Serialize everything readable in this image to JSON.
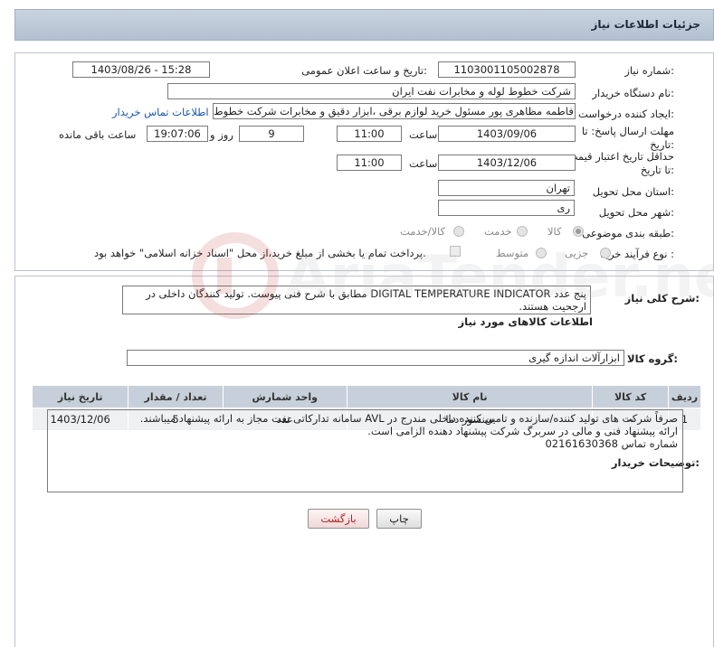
{
  "header": {
    "title": "جزئیات اطلاعات نیاز"
  },
  "form": {
    "need_number_label": "شماره نیاز:",
    "need_number": "1103001105002878",
    "announce_label": "تاریخ و ساعت اعلان عمومی:",
    "announce_value": "1403/08/26 - 15:28",
    "buyer_org_label": "نام دستگاه خریدار:",
    "buyer_org": "شرکت خطوط لوله و مخابرات نفت ایران",
    "requester_label": "ایجاد کننده درخواست:",
    "requester": "فاطمه مظاهری پور مسئول خرید لوازم برقی ،ابزار دقیق و مخابرات شرکت خطوط",
    "contact_link": "اطلاعات تماس خریدار",
    "deadline_label": "مهلت ارسال پاسخ: تا تاریخ:",
    "deadline_date": "1403/09/06",
    "time_label": "ساعت",
    "deadline_time": "11:00",
    "days_value": "9",
    "days_label": "روز و",
    "remaining_time": "19:07:06",
    "remaining_label": "ساعت باقی مانده",
    "validity_label": "حداقل تاریخ اعتبار قیمت: تا تاریخ:",
    "validity_date": "1403/12/06",
    "validity_time": "11:00",
    "province_label": "استان محل تحویل:",
    "province": "تهران",
    "city_label": "شهر محل تحویل:",
    "city": "ری",
    "category_label": "طبقه بندی موضوعی:",
    "category_options": [
      "کالا",
      "خدمت",
      "کالا/خدمت"
    ],
    "process_label": "نوع فرآیند خرید :",
    "process_options": [
      "جزیی",
      "متوسط"
    ],
    "payment_note": "پرداخت تمام یا بخشی از مبلغ خرید،از محل \"اسناد خزانه اسلامی\" خواهد بود."
  },
  "description": {
    "label": "شرح کلی نیاز:",
    "text": "پنج عدد DIGITAL TEMPERATURE INDICATOR مطابق با شرح فنی پیوست. تولید کنندگان داخلی در ارجحیت هستند."
  },
  "goods": {
    "section_title": "اطلاعات کالاهای مورد نیاز",
    "group_label": "گروه کالا:",
    "group_value": "ابزارآلات اندازه گیری",
    "columns": [
      "ردیف",
      "کد کالا",
      "نام کالا",
      "واحد شمارش",
      "تعداد / مقدار",
      "تاریخ نیاز"
    ],
    "rows": [
      {
        "row": "1",
        "code": "--",
        "name": "سنسور دما",
        "unit": "عدد",
        "qty": "5",
        "date": "1403/12/06"
      }
    ]
  },
  "buyer_notes": {
    "label": "توضیحات خریدار:",
    "line1": "صرفاً شرکت های تولید کننده/سازنده و تامین کننده داخلی مندرج در AVL سامانه تدارکاتی نفت مجاز به ارائه پیشنهاد میباشند.",
    "line2": "ارائه پیشنهاد فنی و مالی در سربرگ شرکت پیشنهاد دهنده الزامی است.",
    "line3": "شماره تماس 02161630368"
  },
  "buttons": {
    "print": "چاپ",
    "back": "بازگشت"
  },
  "watermark": {
    "text": "AriaTender.neT"
  }
}
